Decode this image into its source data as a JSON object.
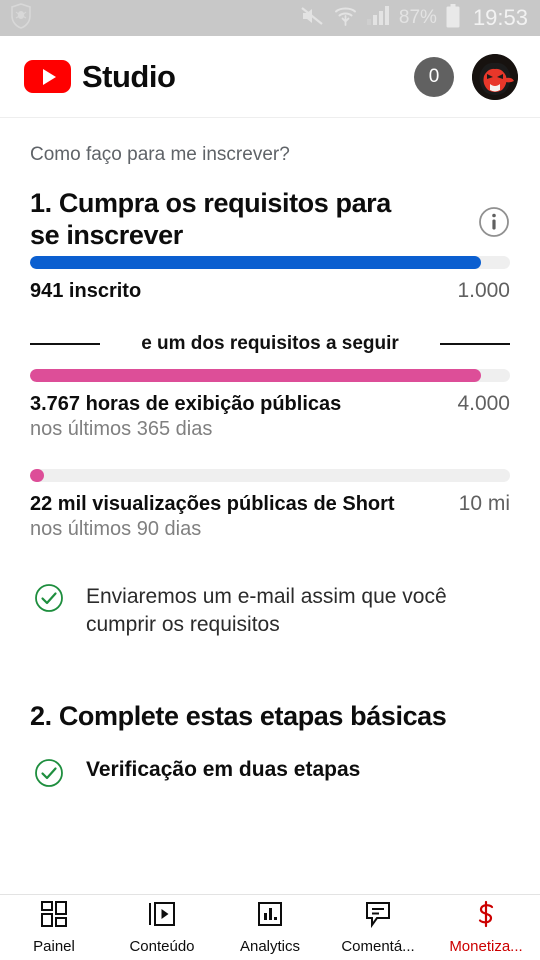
{
  "status_bar": {
    "shield_icon": "shield-icon",
    "mute_icon": "mute-icon",
    "wifi_icon": "wifi-transfer-icon",
    "signal_icon": "cellular-signal-icon",
    "battery_percent": "87%",
    "battery_icon": "battery-icon",
    "clock": "19:53"
  },
  "app_bar": {
    "logo_icon": "youtube-logo-icon",
    "brand": "Studio",
    "notification_count": "0",
    "avatar_icon": "user-avatar"
  },
  "content": {
    "help_link": "Como faço para me inscrever?",
    "step1": {
      "title": "1. Cumpra os requisitos para se inscrever",
      "info_icon": "info-icon",
      "subscribers": {
        "label": "941 inscrito",
        "target": "1.000",
        "sub": "",
        "color": "#0b5fd0",
        "percent": 94
      },
      "divider_text": "e um dos requisitos a seguir",
      "watch_hours": {
        "label": "3.767 horas de exibição públicas",
        "target": "4.000",
        "sub": "nos últimos 365 dias",
        "color": "#dd4e98",
        "percent": 94
      },
      "shorts_views": {
        "label": "22 mil visualizações públicas de Short",
        "target": "10 mi",
        "sub": "nos últimos 90 dias",
        "color": "#dd4e98",
        "percent": 3
      },
      "email_note": "Enviaremos um e-mail assim que você cumprir os requisitos",
      "email_note_icon": "check-circle-icon"
    },
    "step2": {
      "title": "2. Complete estas etapas básicas",
      "first_item": "Verificação em duas etapas",
      "first_item_icon": "check-circle-icon"
    }
  },
  "bottom_nav": {
    "items": [
      {
        "label": "Painel",
        "icon": "dashboard-icon",
        "active": false
      },
      {
        "label": "Conteúdo",
        "icon": "video-library-icon",
        "active": false
      },
      {
        "label": "Analytics",
        "icon": "bar-chart-icon",
        "active": false
      },
      {
        "label": "Comentá...",
        "icon": "comment-icon",
        "active": false
      },
      {
        "label": "Monetiza...",
        "icon": "dollar-icon",
        "active": true
      }
    ]
  },
  "colors": {
    "brand_red": "#ff0000",
    "active_nav": "#cc0000",
    "progress_blue": "#0b5fd0",
    "progress_pink": "#dd4e98",
    "track_gray": "#efefef",
    "check_green": "#1e8e3e"
  }
}
